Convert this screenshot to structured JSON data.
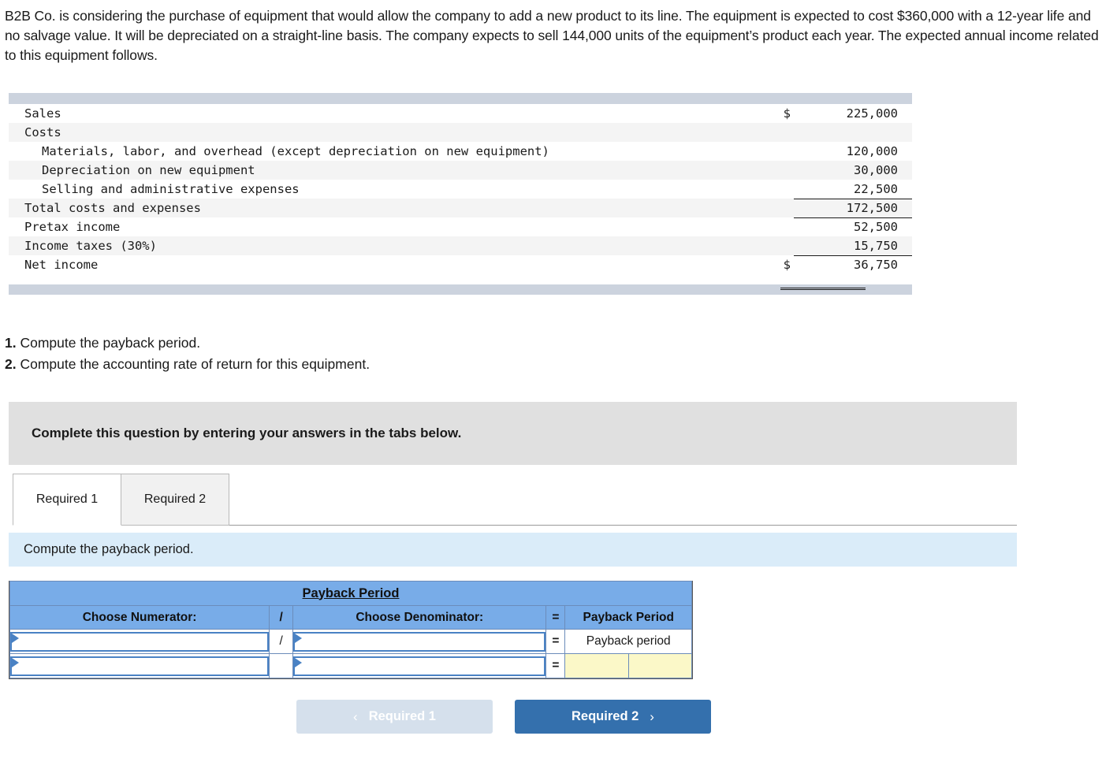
{
  "intro": {
    "paragraph": "B2B Co. is considering the purchase of equipment that would allow the company to add a new product to its line. The equipment is expected to cost $360,000 with a 12-year life and no salvage value. It will be depreciated on a straight-line basis. The company expects to sell 144,000 units of the equipment’s product each year. The expected annual income related to this equipment follows."
  },
  "income_statement": {
    "rows": [
      {
        "label": "Sales",
        "currency": "$",
        "amount": "225,000"
      },
      {
        "label": "Costs",
        "currency": "",
        "amount": ""
      },
      {
        "label": "Materials, labor, and overhead (except depreciation on new equipment)",
        "currency": "",
        "amount": "120,000"
      },
      {
        "label": "Depreciation on new equipment",
        "currency": "",
        "amount": "30,000"
      },
      {
        "label": "Selling and administrative expenses",
        "currency": "",
        "amount": "22,500"
      },
      {
        "label": "Total costs and expenses",
        "currency": "",
        "amount": "172,500"
      },
      {
        "label": "Pretax income",
        "currency": "",
        "amount": "52,500"
      },
      {
        "label": "Income taxes (30%)",
        "currency": "",
        "amount": "15,750"
      },
      {
        "label": "Net income",
        "currency": "$",
        "amount": "36,750"
      }
    ]
  },
  "requirements": {
    "items": [
      {
        "number": "1.",
        "text": " Compute the payback period."
      },
      {
        "number": "2.",
        "text": " Compute the accounting rate of return for this equipment."
      }
    ]
  },
  "banner": {
    "text": "Complete this question by entering your answers in the tabs below."
  },
  "tabs": [
    {
      "label": "Required 1",
      "active": true
    },
    {
      "label": "Required 2",
      "active": false
    }
  ],
  "prompt": {
    "text": "Compute the payback period."
  },
  "payback_table": {
    "title": "Payback Period",
    "headers": {
      "numerator": "Choose Numerator:",
      "slash": "/",
      "denominator": "Choose Denominator:",
      "equals": "=",
      "result": "Payback Period"
    },
    "rows": [
      {
        "numerator_value": "",
        "numerator_placeholder": "",
        "slash": "/",
        "denominator_value": "",
        "denominator_placeholder": "",
        "equals": "=",
        "result_label": "Payback period",
        "result_value": ""
      },
      {
        "numerator_value": "",
        "numerator_placeholder": "",
        "slash": "",
        "denominator_value": "",
        "denominator_placeholder": "",
        "equals": "=",
        "result_left_value": "",
        "result_right_value": ""
      }
    ]
  },
  "navigation": {
    "prev_label": "Required 1",
    "prev_icon": "chevron-left",
    "prev_glyph": "‹",
    "next_label": "Required 2",
    "next_icon": "chevron-right",
    "next_glyph": "›"
  },
  "colors": {
    "table_bar": "#ccd3de",
    "row_shade": "#f4f4f4",
    "banner_gray": "#e0e0e0",
    "prompt_blue": "#daecf9",
    "header_blue": "#78ace8",
    "input_border_blue": "#4a82c4",
    "answer_yellow": "#fbf8c8",
    "btn_next_blue": "#3470ad",
    "btn_prev_gray": "#d5e0ec"
  }
}
